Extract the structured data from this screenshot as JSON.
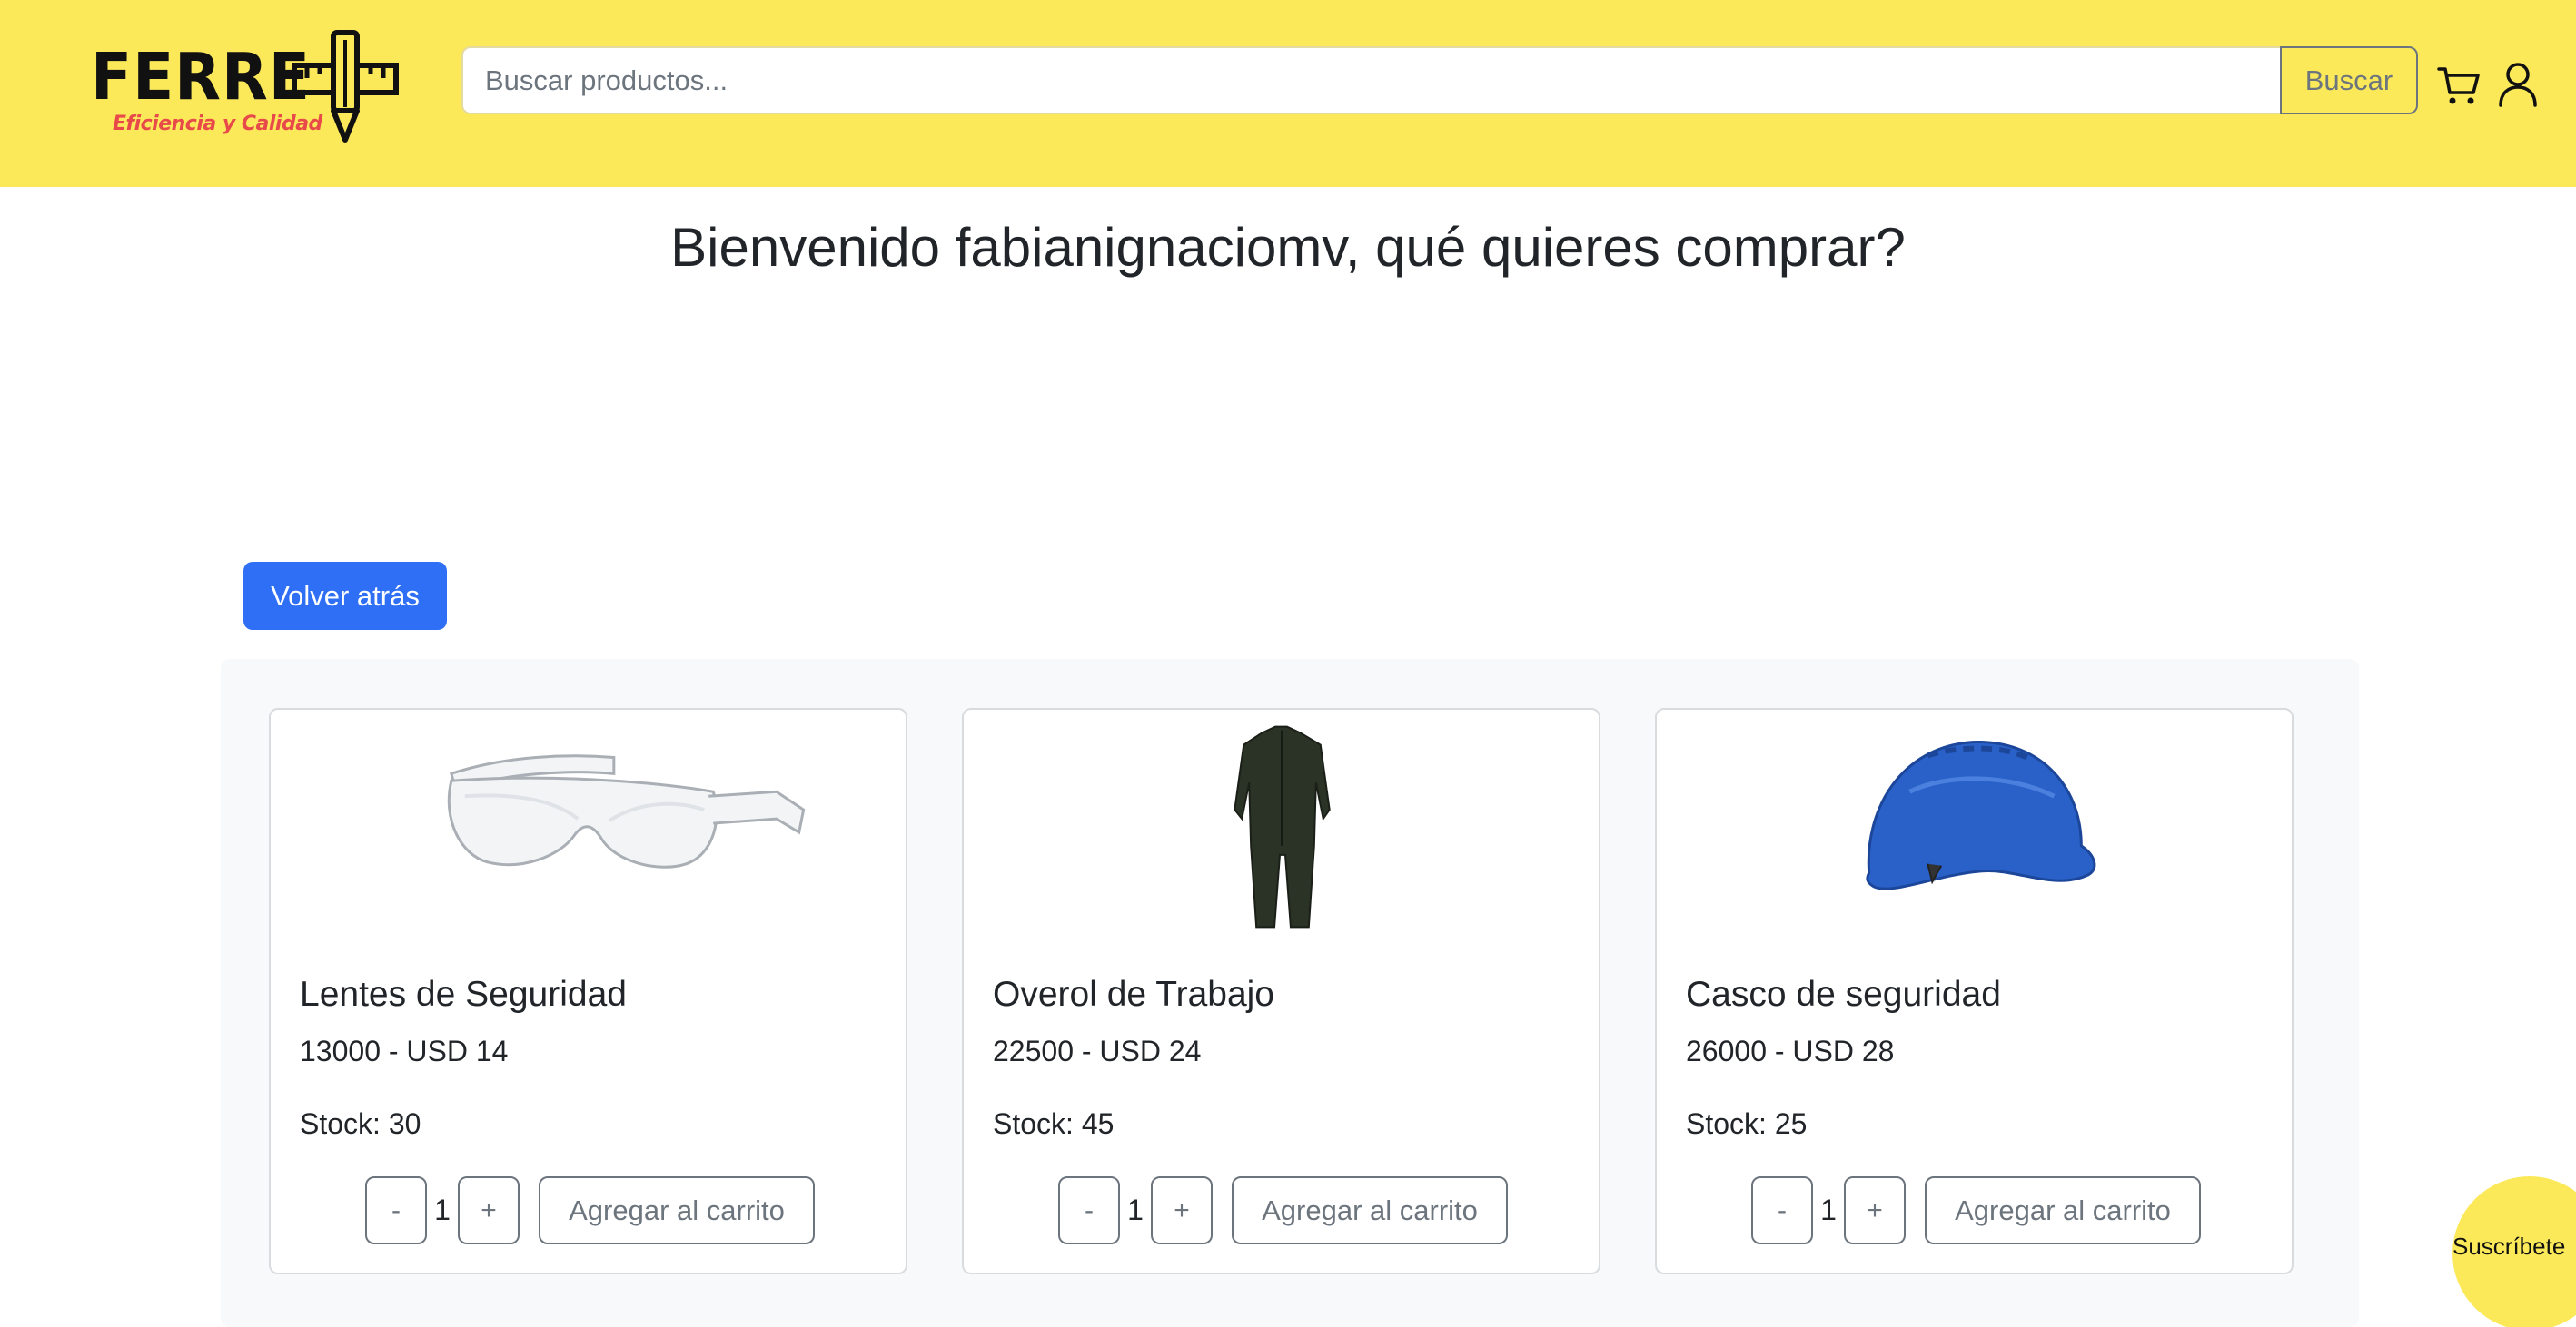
{
  "header": {
    "logo_text": "FERRE",
    "logo_tagline": "Eficiencia y Calidad",
    "search_placeholder": "Buscar productos...",
    "search_value": "",
    "search_button": "Buscar",
    "cart_icon": "cart-icon",
    "user_icon": "user-icon"
  },
  "main": {
    "title": "Bienvenido fabianignaciomv, qué quieres comprar?",
    "back_button": "Volver atrás"
  },
  "products": [
    {
      "name": "Lentes de Seguridad",
      "price": "13000 - USD 14",
      "stock": "Stock: 30",
      "quantity": "1",
      "minus": "-",
      "plus": "+",
      "add_button": "Agregar al carrito",
      "image": "safety-glasses"
    },
    {
      "name": "Overol de Trabajo",
      "price": "22500 - USD 24",
      "stock": "Stock: 45",
      "quantity": "1",
      "minus": "-",
      "plus": "+",
      "add_button": "Agregar al carrito",
      "image": "work-coverall"
    },
    {
      "name": "Casco de seguridad",
      "price": "26000 - USD 28",
      "stock": "Stock: 25",
      "quantity": "1",
      "minus": "-",
      "plus": "+",
      "add_button": "Agregar al carrito",
      "image": "safety-helmet"
    }
  ],
  "subscribe": {
    "label": "Suscríbete"
  },
  "colors": {
    "header_bg": "#fbe95a",
    "primary": "#2f6ff5",
    "logo_accent": "#e84a4a",
    "secondary": "#6c757d"
  }
}
